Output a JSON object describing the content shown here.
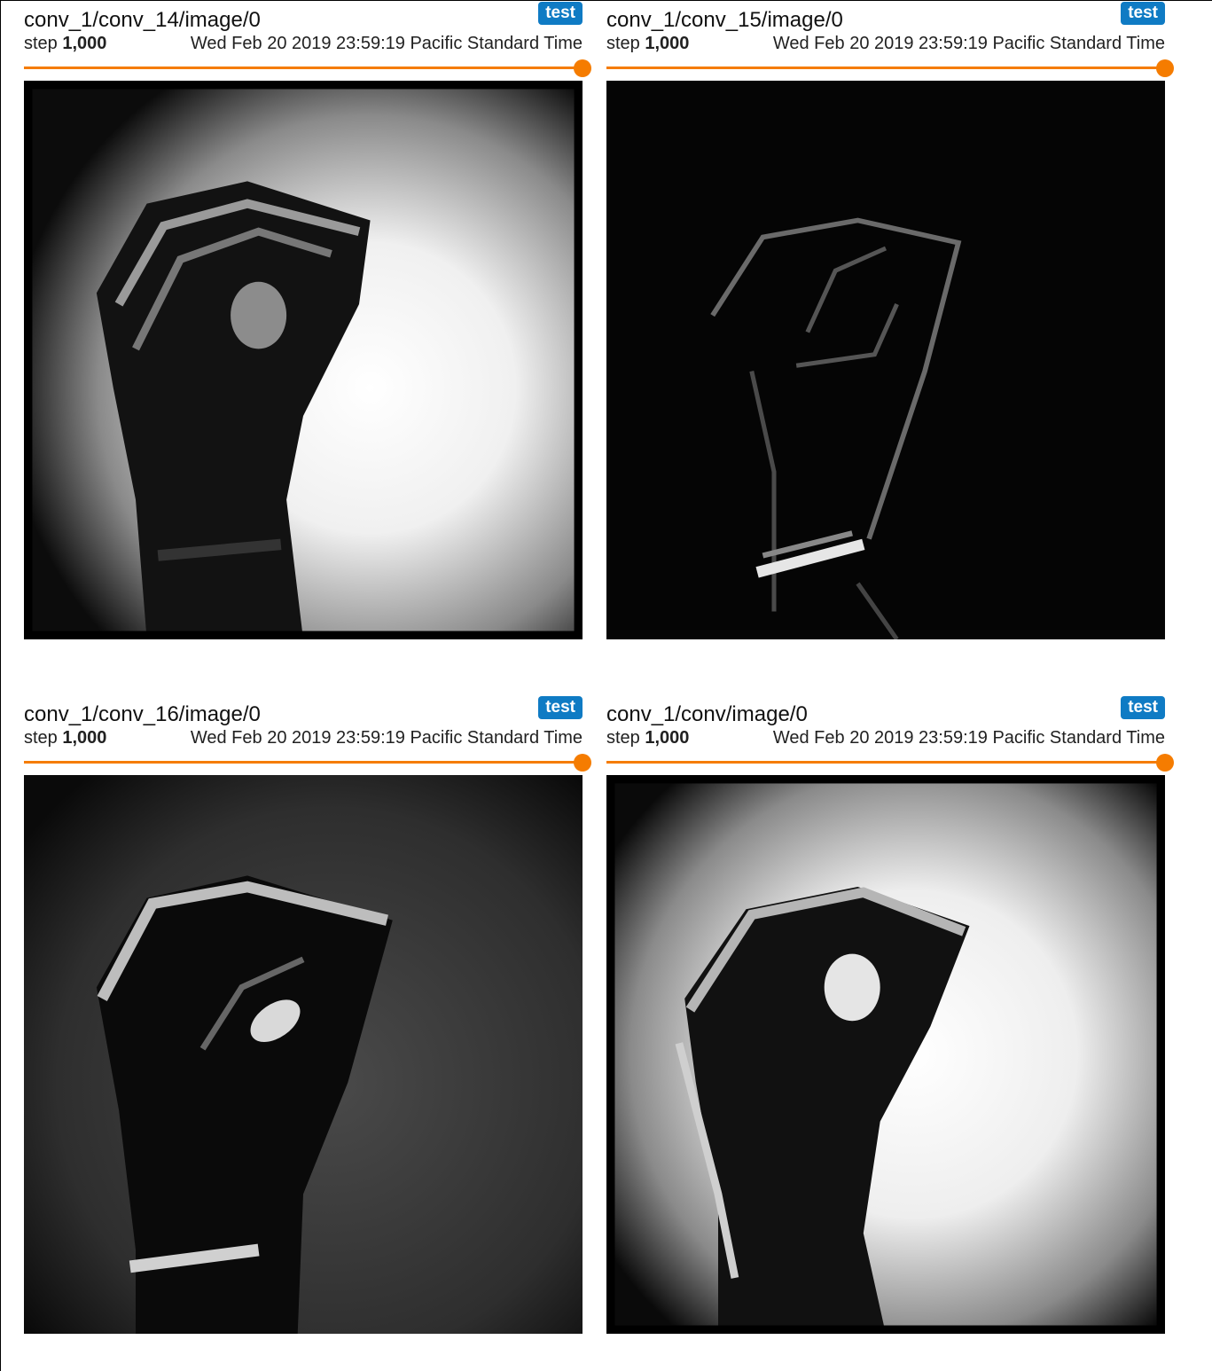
{
  "cards": [
    {
      "title": "conv_1/conv_14/image/0",
      "run": "test",
      "step_label": "step",
      "step_value": "1,000",
      "wall_time": "Wed Feb 20 2019 23:59:19 Pacific Standard Time",
      "slider_value": 1.0,
      "image_icon": "activation-map-image"
    },
    {
      "title": "conv_1/conv_15/image/0",
      "run": "test",
      "step_label": "step",
      "step_value": "1,000",
      "wall_time": "Wed Feb 20 2019 23:59:19 Pacific Standard Time",
      "slider_value": 1.0,
      "image_icon": "activation-map-image"
    },
    {
      "title": "conv_1/conv_16/image/0",
      "run": "test",
      "step_label": "step",
      "step_value": "1,000",
      "wall_time": "Wed Feb 20 2019 23:59:19 Pacific Standard Time",
      "slider_value": 1.0,
      "image_icon": "activation-map-image"
    },
    {
      "title": "conv_1/conv/image/0",
      "run": "test",
      "step_label": "step",
      "step_value": "1,000",
      "wall_time": "Wed Feb 20 2019 23:59:19 Pacific Standard Time",
      "slider_value": 1.0,
      "image_icon": "activation-map-image"
    }
  ],
  "colors": {
    "badge": "#0f7bc4",
    "slider": "#f57c00"
  }
}
